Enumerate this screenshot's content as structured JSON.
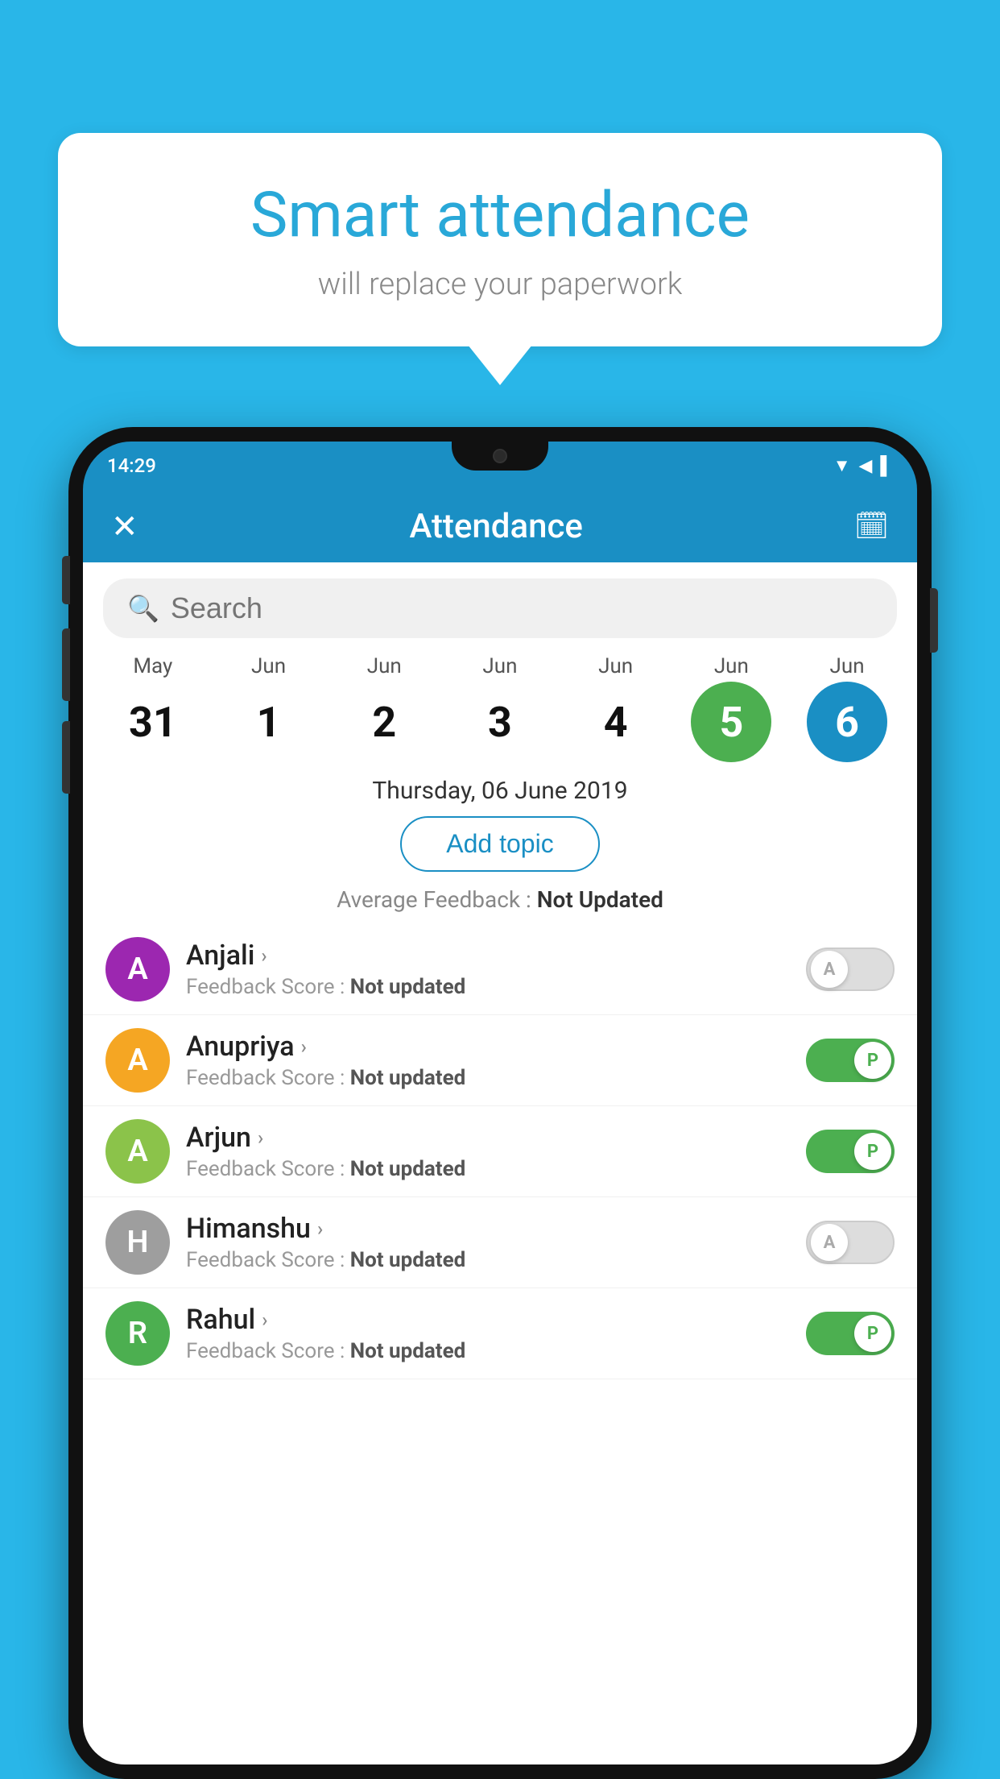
{
  "background": {
    "color": "#29b6e8"
  },
  "speech_bubble": {
    "title": "Smart attendance",
    "subtitle": "will replace your paperwork"
  },
  "status_bar": {
    "time": "14:29",
    "icons": [
      "▼",
      "◀",
      "▌"
    ]
  },
  "app_header": {
    "close_label": "✕",
    "title": "Attendance",
    "calendar_icon": "📅"
  },
  "search": {
    "placeholder": "Search"
  },
  "calendar": {
    "days": [
      {
        "month": "May",
        "date": "31",
        "style": "normal"
      },
      {
        "month": "Jun",
        "date": "1",
        "style": "normal"
      },
      {
        "month": "Jun",
        "date": "2",
        "style": "normal"
      },
      {
        "month": "Jun",
        "date": "3",
        "style": "normal"
      },
      {
        "month": "Jun",
        "date": "4",
        "style": "normal"
      },
      {
        "month": "Jun",
        "date": "5",
        "style": "today"
      },
      {
        "month": "Jun",
        "date": "6",
        "style": "selected"
      }
    ]
  },
  "selected_date": "Thursday, 06 June 2019",
  "add_topic_btn": "Add topic",
  "avg_feedback": {
    "label": "Average Feedback : ",
    "value": "Not Updated"
  },
  "students": [
    {
      "name": "Anjali",
      "avatar_letter": "A",
      "avatar_color": "#9c27b0",
      "feedback": "Not updated",
      "toggle": "off",
      "toggle_label": "A"
    },
    {
      "name": "Anupriya",
      "avatar_letter": "A",
      "avatar_color": "#f5a623",
      "feedback": "Not updated",
      "toggle": "on",
      "toggle_label": "P"
    },
    {
      "name": "Arjun",
      "avatar_letter": "A",
      "avatar_color": "#8bc34a",
      "feedback": "Not updated",
      "toggle": "on",
      "toggle_label": "P"
    },
    {
      "name": "Himanshu",
      "avatar_letter": "H",
      "avatar_color": "#9e9e9e",
      "feedback": "Not updated",
      "toggle": "off",
      "toggle_label": "A"
    },
    {
      "name": "Rahul",
      "avatar_letter": "R",
      "avatar_color": "#4caf50",
      "feedback": "Not updated",
      "toggle": "on",
      "toggle_label": "P"
    }
  ]
}
